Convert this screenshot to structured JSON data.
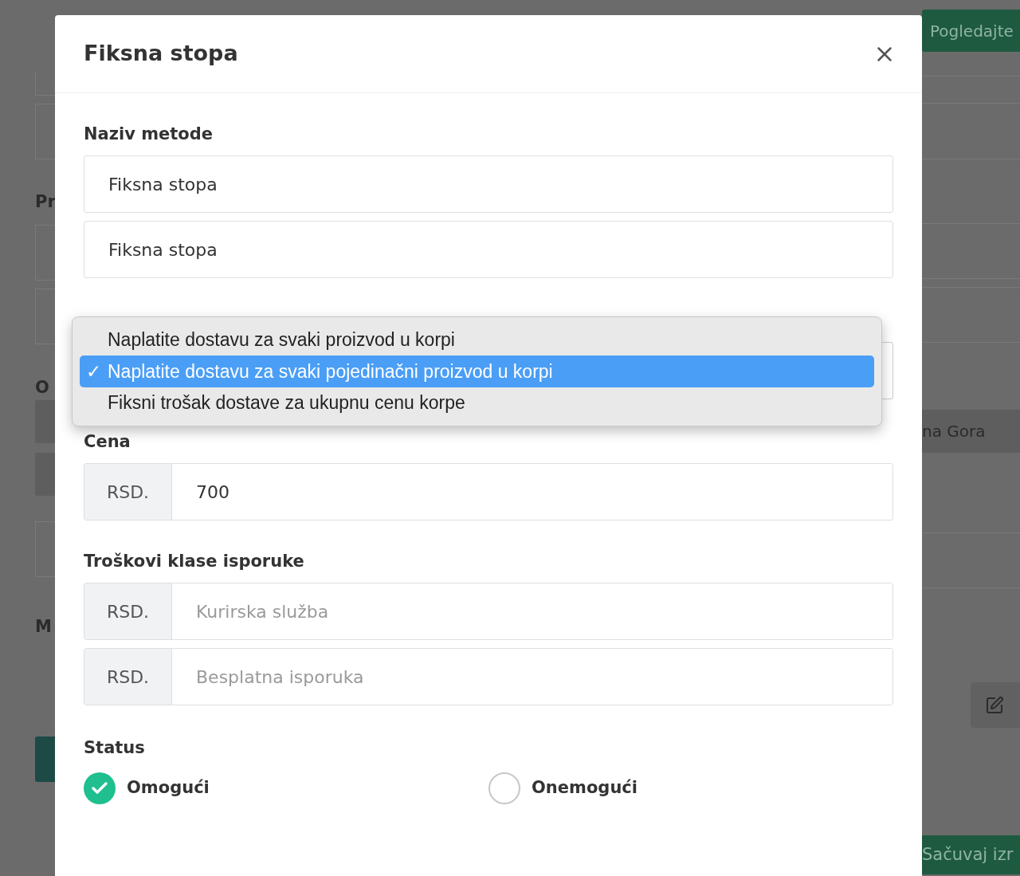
{
  "background": {
    "top_button": "Pogledajte",
    "left_headings": [
      "Pr",
      "O",
      "M"
    ],
    "right_row": "na Gora",
    "bottom_button": "Sačuvaj izr"
  },
  "modal": {
    "title": "Fiksna stopa",
    "method_name": {
      "label": "Naziv metode",
      "values": [
        "Fiksna stopa",
        "Fiksna stopa"
      ]
    },
    "calc_dropdown": {
      "check_mark": "✓",
      "options": [
        {
          "label": "Naplatite dostavu za svaki proizvod u korpi",
          "selected": false
        },
        {
          "label": "Naplatite dostavu za svaki pojedinačni proizvod u korpi",
          "selected": true
        },
        {
          "label": "Fiksni trošak dostave za ukupnu cenu korpe",
          "selected": false
        }
      ]
    },
    "price": {
      "label": "Cena",
      "prefix": "RSD.",
      "value": "700"
    },
    "class_costs": {
      "label": "Troškovi klase isporuke",
      "rows": [
        {
          "prefix": "RSD.",
          "placeholder": "Kurirska služba"
        },
        {
          "prefix": "RSD.",
          "placeholder": "Besplatna isporuka"
        }
      ]
    },
    "status": {
      "label": "Status",
      "options": [
        {
          "label": "Omogući",
          "selected": true
        },
        {
          "label": "Onemogući",
          "selected": false
        }
      ]
    }
  }
}
